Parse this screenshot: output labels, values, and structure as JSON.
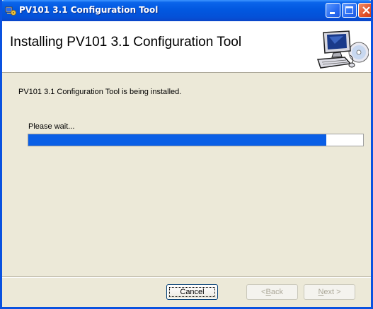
{
  "window": {
    "title": "PV101 3.1 Configuration Tool"
  },
  "banner": {
    "title": "Installing PV101 3.1 Configuration Tool",
    "graphic_icon": "computer-cd-icon"
  },
  "main": {
    "status_text": "PV101 3.1 Configuration Tool is being installed.",
    "wait_text": "Please wait...",
    "progress_fraction": 0.89
  },
  "buttons": {
    "cancel_label": "Cancel",
    "back_label_prefix": "< ",
    "back_label_mnemonic": "B",
    "back_label_rest": "ack",
    "next_label_mnemonic": "N",
    "next_label_rest": "ext >"
  },
  "colors": {
    "titlebar": "#0258e0",
    "progress_fill": "#0a5fe6",
    "close_button": "#e0512a",
    "dialog_bg": "#ece9d8"
  }
}
